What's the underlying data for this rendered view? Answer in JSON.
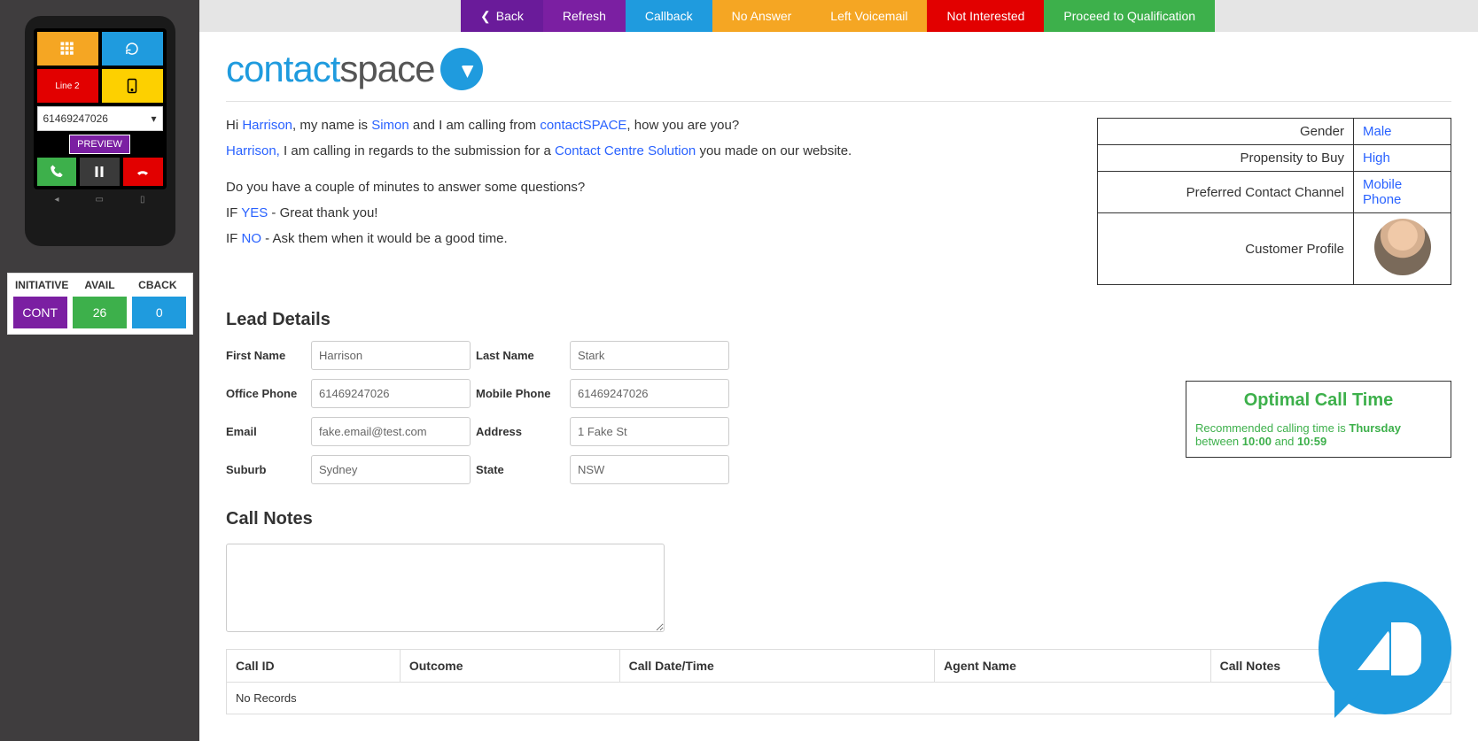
{
  "phone": {
    "line2": "Line 2",
    "number": "61469247026",
    "preview": "PREVIEW"
  },
  "status": {
    "headers": [
      "INITIATIVE",
      "AVAIL",
      "CBACK"
    ],
    "initiative": "CONT",
    "avail": "26",
    "cback": "0"
  },
  "topbar": {
    "back": "Back",
    "refresh": "Refresh",
    "callback": "Callback",
    "noanswer": "No Answer",
    "leftvm": "Left Voicemail",
    "notinterested": "Not Interested",
    "proceed": "Proceed to Qualification"
  },
  "logo": {
    "contact": "contact",
    "space": "space"
  },
  "script": {
    "hi": "Hi ",
    "name": "Harrison",
    "myname": ", my name is ",
    "agent": "Simon",
    "calling": " and I am calling from ",
    "company": "contactSPACE",
    "how": ", how you are you?",
    "line2a": "Harrison,",
    "line2b": " I am calling in regards to the submission for a ",
    "solution": "Contact Centre Solution",
    "line2c": " you made on our website.",
    "q": "Do you have a couple of minutes to answer some questions?",
    "ifyes_pre": "IF ",
    "yes": "YES",
    "ifyes_post": " - Great thank you!",
    "ifno_pre": "IF ",
    "no": "NO",
    "ifno_post": " - Ask them when it would be a good time."
  },
  "info": {
    "gender_label": "Gender",
    "gender": "Male",
    "propensity_label": "Propensity to Buy",
    "propensity": "High",
    "channel_label": "Preferred Contact Channel",
    "channel": "Mobile Phone",
    "profile_label": "Customer Profile"
  },
  "lead": {
    "title": "Lead Details",
    "first_name_label": "First Name",
    "first_name": "Harrison",
    "last_name_label": "Last Name",
    "last_name": "Stark",
    "office_label": "Office Phone",
    "office": "61469247026",
    "mobile_label": "Mobile Phone",
    "mobile": "61469247026",
    "email_label": "Email",
    "email": "fake.email@test.com",
    "address_label": "Address",
    "address": "1 Fake St",
    "suburb_label": "Suburb",
    "suburb": "Sydney",
    "state_label": "State",
    "state": "NSW"
  },
  "optimal": {
    "title": "Optimal Call Time",
    "pre": "Recommended calling time is ",
    "day": "Thursday",
    "mid": " between ",
    "t1": "10:00",
    "and": " and ",
    "t2": "10:59"
  },
  "notes": {
    "title": "Call Notes"
  },
  "history": {
    "callid": "Call ID",
    "outcome": "Outcome",
    "datetime": "Call Date/Time",
    "agent": "Agent Name",
    "notes": "Call Notes",
    "norecords": "No Records"
  }
}
